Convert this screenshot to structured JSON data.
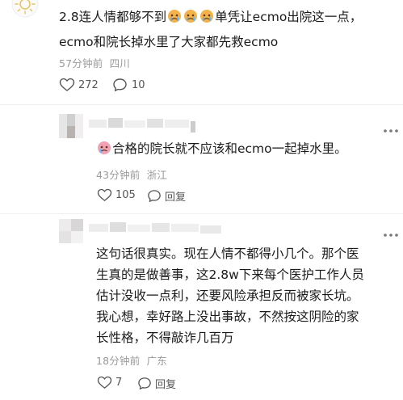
{
  "comments": [
    {
      "text_line1_a": "2.8连人情都够不到",
      "text_line1_b": "单凭让ecmo出院这一点，",
      "text_line2": "ecmo和院长掉水里了大家都先救ecmo",
      "time": "57分钟前",
      "location": "四川",
      "likes": "272",
      "replies": "10"
    },
    {
      "text": "合格的院长就不应该和ecmo一起掉水里。",
      "time": "43分钟前",
      "location": "浙江",
      "likes": "105",
      "reply_label": "回复"
    },
    {
      "lines": [
        "这句话很真实。现在人情不都得小几个。那个医",
        "生真的是做善事，这2.8w下来每个医护工作人员",
        "估计没收一点利，还要风险承担反而被家长坑。",
        "我心想，幸好路上没出事故，不然按这阴险的家",
        "长性格，不得敲诈几百万"
      ],
      "time": "18分钟前",
      "location": "广东",
      "likes": "7",
      "reply_label": "回复"
    }
  ],
  "icons": {
    "avatar_top": "sun-avatar-icon",
    "like": "heart-icon",
    "comment": "speech-bubble-icon",
    "more": "more-dots-icon",
    "emoji": "crying-face-emoji-icon"
  },
  "colors": {
    "text": "#1a1a1a",
    "meta": "#9a9a9a",
    "action": "#555555"
  }
}
